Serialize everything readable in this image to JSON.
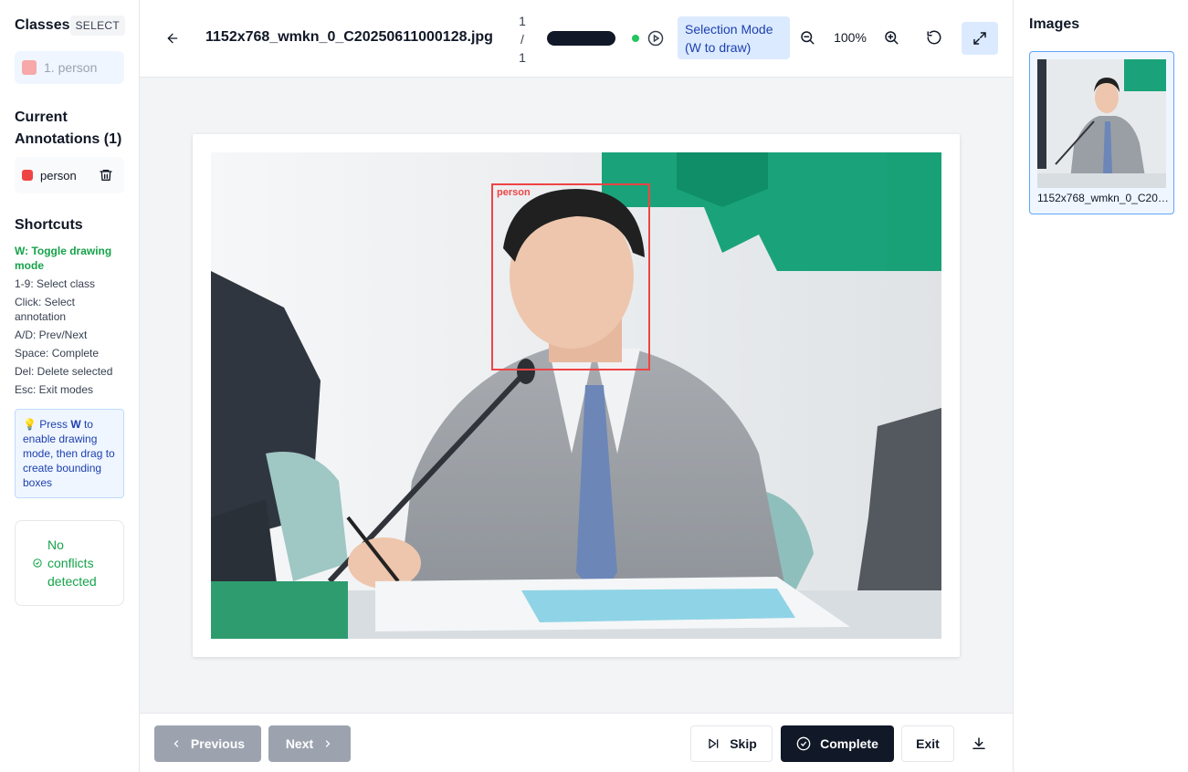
{
  "sidebar": {
    "classes_title": "Classes",
    "select_badge": "SELECT",
    "classes": [
      {
        "label": "1. person",
        "color": "#f7a8a8"
      }
    ],
    "current_annotations_title": "Current Annotations (1)",
    "annotations": [
      {
        "label": "person",
        "color": "#ef4444"
      }
    ],
    "shortcuts_title": "Shortcuts",
    "shortcuts": [
      "W: Toggle drawing mode",
      "1-9: Select class",
      "Click: Select annotation",
      "A/D: Prev/Next",
      "Space: Complete",
      "Del: Delete selected",
      "Esc: Exit modes"
    ],
    "tip": {
      "icon": "💡",
      "pre": "Press ",
      "key": "W",
      "post": " to enable drawing mode, then drag to create bounding boxes"
    },
    "conflict_text": "No conflicts detected"
  },
  "topbar": {
    "filename": "1152x768_wmkn_0_C20250611000128.jpg",
    "counter_current": "1",
    "counter_sep": "/",
    "counter_total": "1",
    "mode_label": "Selection Mode (W to draw)",
    "zoom_level": "100%",
    "status_color": "#22c55e"
  },
  "canvas": {
    "bbox_label": "person"
  },
  "bottombar": {
    "previous_label": "Previous",
    "next_label": "Next",
    "skip_label": "Skip",
    "complete_label": "Complete",
    "exit_label": "Exit"
  },
  "right_panel": {
    "title": "Images",
    "thumb_caption": "1152x768_wmkn_0_C20250611000128.jpg"
  }
}
